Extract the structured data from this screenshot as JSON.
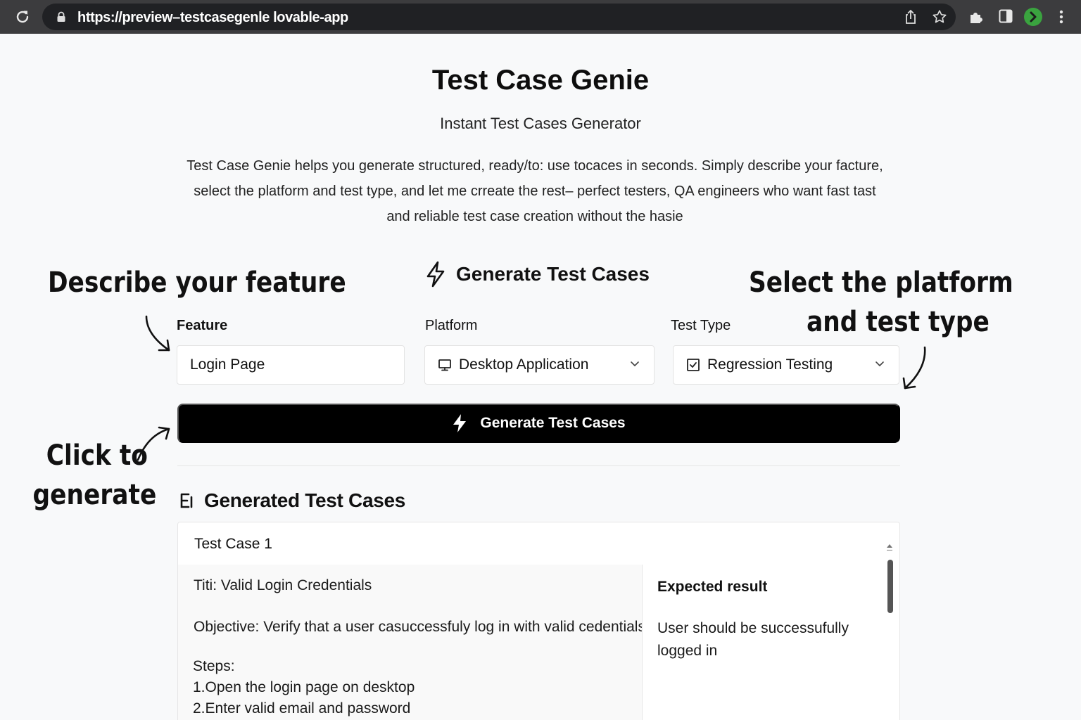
{
  "browser": {
    "url": "https://preview–testcasegenle lovable-app"
  },
  "header": {
    "title": "Test Case Genie",
    "subtitle": "Instant Test Cases Generator",
    "description_lines": [
      "Test Case Genie helps you generate structured, ready/to: use tocaces in seconds. Simply describe your facture,",
      "select the platform and test type, and let me crreate the rest– perfect testers, QA engineers who want fast tast",
      "and reliable test case creation without the hasie"
    ]
  },
  "annotations": {
    "feature": "Describe your feature",
    "platform_lines": [
      "Select the platform",
      "and test type"
    ],
    "click_lines": [
      "Click to",
      "generate"
    ]
  },
  "form": {
    "heading": "Generate Test Cases",
    "feature_label": "Feature",
    "feature_value": "Login Page",
    "platform_label": "Platform",
    "platform_value": "Desktop Application",
    "type_label": "Test Type",
    "type_value": "Regression Testing",
    "generate_label": "Generate Test Cases"
  },
  "results": {
    "heading": "Generated Test Cases",
    "cases": [
      {
        "name": "Test Case 1",
        "title": "Titi: Valid Login Credentials",
        "objective": "Objective: Verify that a user casuccessfuly log in with valid cedentials",
        "steps_label": "Steps:",
        "steps": [
          "1.Open the login page on desktop",
          "2.Enter valid email and password"
        ],
        "expected_label": "Expected result",
        "expected_value": "User should be successufully logged in"
      }
    ]
  },
  "icons": {
    "reload": "reload-icon",
    "lock": "lock-icon",
    "share": "share-icon",
    "star": "star-icon",
    "extensions": "puzzle-icon",
    "sidepanel": "side-panel-icon",
    "menu": "kebab-menu-icon",
    "bolt": "bolt-icon",
    "monitor": "monitor-icon",
    "checkbox": "test-type-icon",
    "results": "list-icon"
  },
  "colors": {
    "button_bg": "#000000",
    "profile": "#3aa33f",
    "chrome": "#3c3c3e"
  }
}
